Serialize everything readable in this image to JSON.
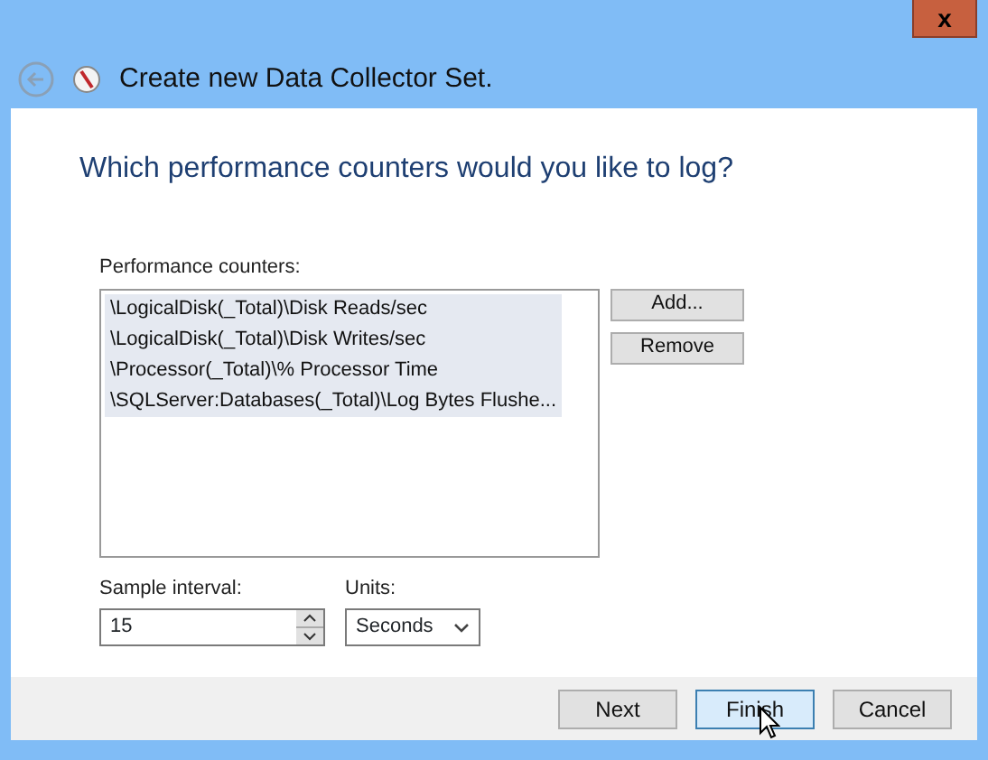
{
  "window": {
    "title": "Create new Data Collector Set."
  },
  "heading": "Which performance counters would you like to log?",
  "counters": {
    "label": "Performance counters:",
    "items": [
      {
        "text": "\\LogicalDisk(_Total)\\Disk Reads/sec",
        "selected": true
      },
      {
        "text": "\\LogicalDisk(_Total)\\Disk Writes/sec",
        "selected": true
      },
      {
        "text": "\\Processor(_Total)\\% Processor Time",
        "selected": true
      },
      {
        "text": "\\SQLServer:Databases(_Total)\\Log Bytes Flushe...",
        "selected": true
      }
    ]
  },
  "side_buttons": [
    "Add...",
    "Remove"
  ],
  "sample_interval": {
    "label": "Sample interval:",
    "value": "15"
  },
  "units": {
    "label": "Units:",
    "value": "Seconds"
  },
  "footer_buttons": [
    {
      "label": "Next",
      "default": false
    },
    {
      "label": "Finish",
      "default": true
    },
    {
      "label": "Cancel",
      "default": false
    }
  ],
  "close": "x"
}
